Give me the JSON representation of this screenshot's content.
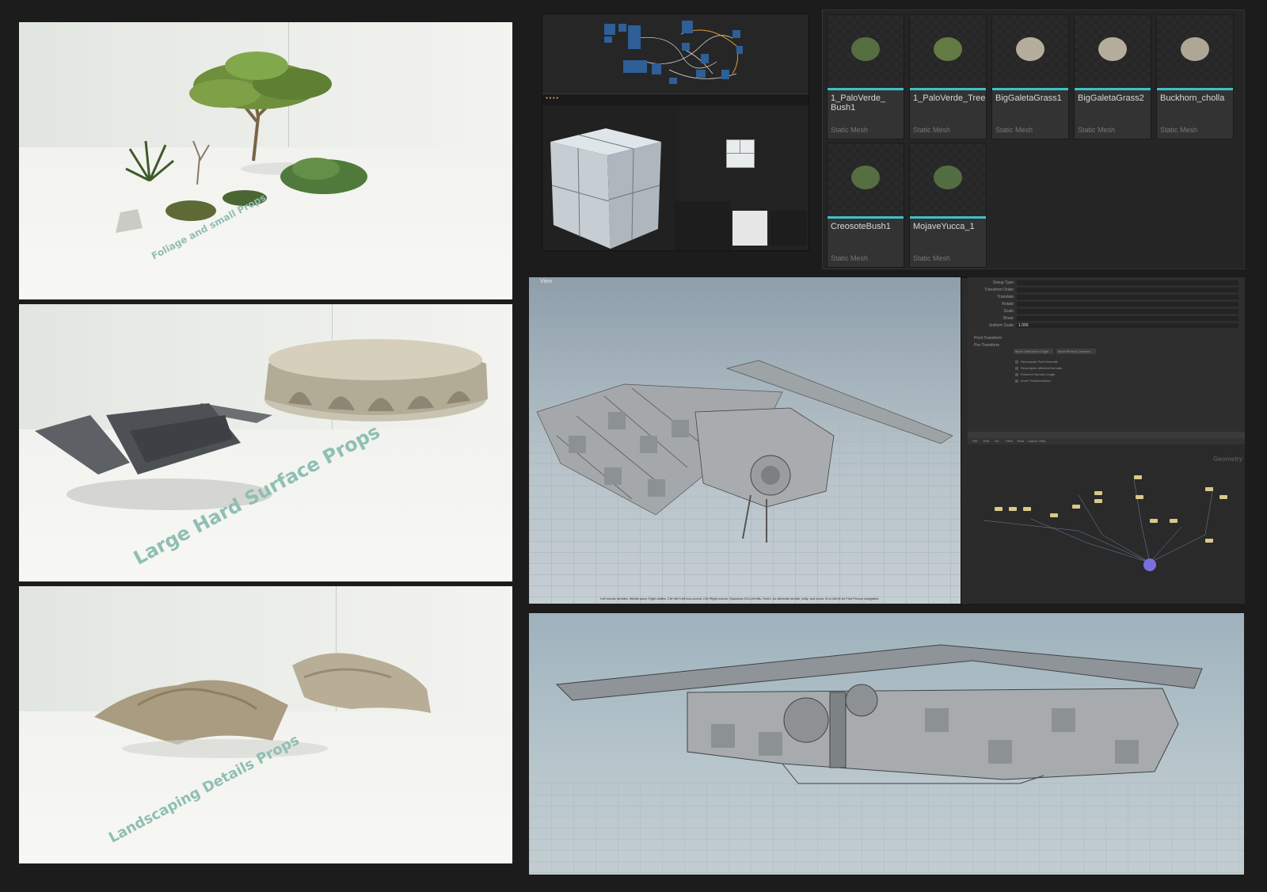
{
  "renders": {
    "foliage_caption": "Foliage and small Props",
    "hardsurface_caption": "Large Hard Surface Props",
    "landscape_caption": "Landscaping Details Props"
  },
  "content_browser": {
    "assets": [
      {
        "name": "1_PaloVerde_\nBush1",
        "type": "Static Mesh",
        "icon": "bush-thumbnail"
      },
      {
        "name": "1_PaloVerde_Tree",
        "type": "Static Mesh",
        "icon": "tree-thumbnail"
      },
      {
        "name": "BigGaletaGrass1",
        "type": "Static Mesh",
        "icon": "grass-thumbnail"
      },
      {
        "name": "BigGaletaGrass2",
        "type": "Static Mesh",
        "icon": "grass-thumbnail"
      },
      {
        "name": "Buckhorn_cholla",
        "type": "Static Mesh",
        "icon": "cactus-thumbnail"
      },
      {
        "name": "CreosoteBush1",
        "type": "Static Mesh",
        "icon": "bush-thumbnail"
      },
      {
        "name": "MojaveYucca_1",
        "type": "Static Mesh",
        "icon": "yucca-thumbnail"
      }
    ],
    "accent_color": "#3fc1c9"
  },
  "houdini": {
    "viewport_label": "View",
    "param_labels": [
      "Group Type",
      "Transform Order",
      "Translate",
      "Rotate",
      "Scale",
      "Shear",
      "Uniform Scale"
    ],
    "uniform_scale_value": "1.000",
    "sections": [
      "Pivot Transform",
      "Pre-Transform"
    ],
    "buttons": [
      "Move Centroid to Origin",
      "Move Pivot to Centroid"
    ],
    "checkboxes": [
      "Recompute Point Normals",
      "Recompute Affected Normals",
      "Preserve Normal Length",
      "Invert Transformation"
    ],
    "network_menu": [
      "File",
      "Edit",
      "Go",
      "View",
      "Tools",
      "Layout",
      "Help"
    ],
    "network_context": "Geometry",
    "status_text": "Left mouse tumbles. Middle pans. Right dollies. Ctrl+Alt+Left box-zooms. Ctrl+Right zooms. Spacebar-Ctrl-Left tilts. Hold L for alternate tumble, dolly, and zoom. M or Alt+M for First Person navigation."
  }
}
